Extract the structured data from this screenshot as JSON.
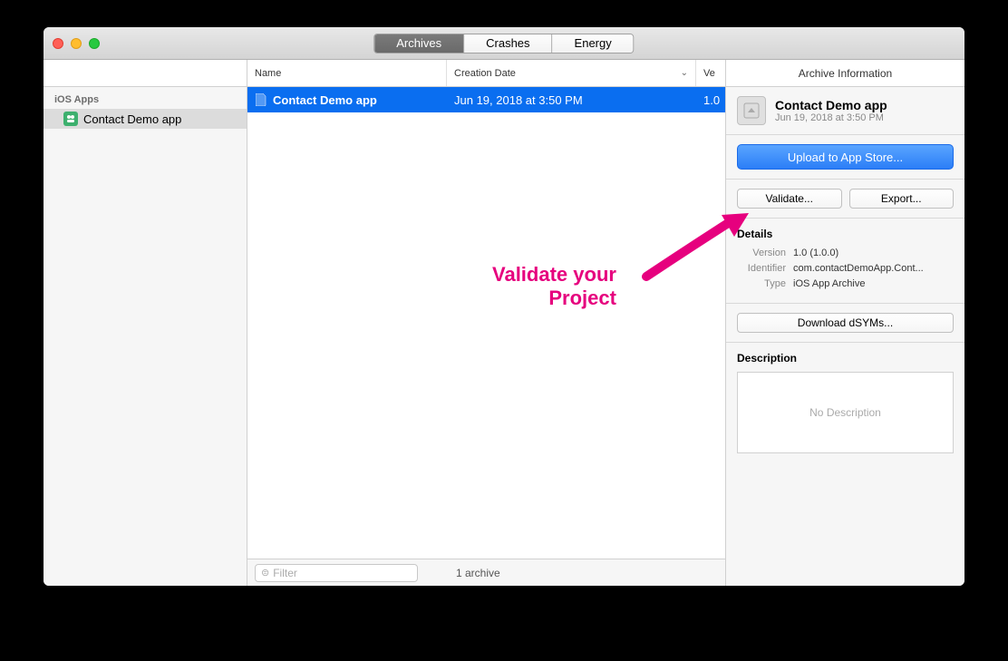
{
  "tabs": {
    "archives": "Archives",
    "crashes": "Crashes",
    "energy": "Energy"
  },
  "sidebar": {
    "section_title": "iOS Apps",
    "items": [
      {
        "label": "Contact Demo app"
      }
    ]
  },
  "table": {
    "headers": {
      "name": "Name",
      "date": "Creation Date",
      "version": "Ve"
    },
    "rows": [
      {
        "name": "Contact Demo app",
        "date": "Jun 19, 2018 at 3:50 PM",
        "version": "1.0"
      }
    ]
  },
  "footer": {
    "filter_placeholder": "Filter",
    "count_text": "1 archive"
  },
  "inspector": {
    "title": "Archive Information",
    "archive_name": "Contact Demo app",
    "archive_date": "Jun 19, 2018 at 3:50 PM",
    "upload_label": "Upload to App Store...",
    "validate_label": "Validate...",
    "export_label": "Export...",
    "details_title": "Details",
    "version_label": "Version",
    "version_value": "1.0 (1.0.0)",
    "identifier_label": "Identifier",
    "identifier_value": "com.contactDemoApp.Cont...",
    "type_label": "Type",
    "type_value": "iOS App Archive",
    "download_dsyms_label": "Download dSYMs...",
    "description_title": "Description",
    "no_description": "No Description"
  },
  "annotation": {
    "line1": "Validate your",
    "line2": "Project"
  }
}
